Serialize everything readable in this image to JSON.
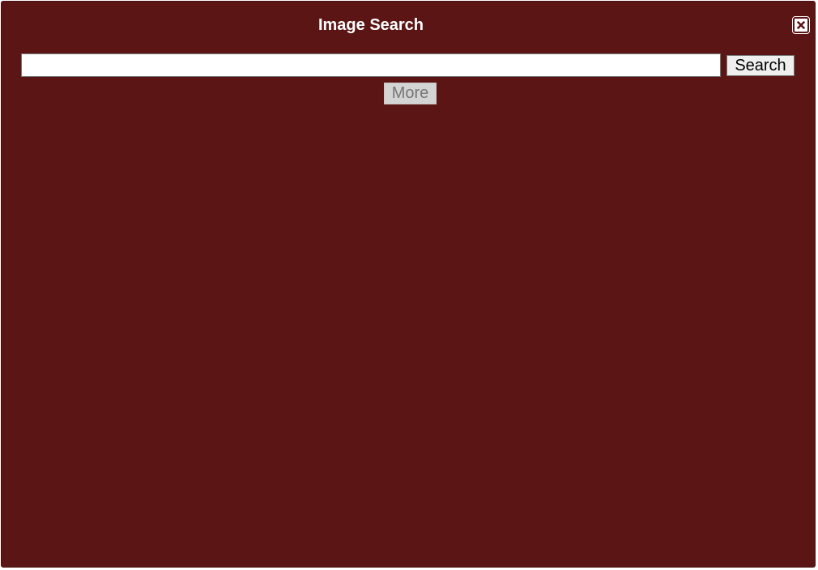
{
  "dialog": {
    "title": "Image Search",
    "close_icon": "close-icon"
  },
  "search": {
    "value": "",
    "placeholder": "",
    "button_label": "Search"
  },
  "more": {
    "label": "More",
    "disabled": true
  },
  "colors": {
    "background": "#5c1515",
    "title_text": "#ffffff",
    "button_bg": "#efefef",
    "disabled_bg": "#d4d4d4",
    "disabled_text": "#767676"
  }
}
